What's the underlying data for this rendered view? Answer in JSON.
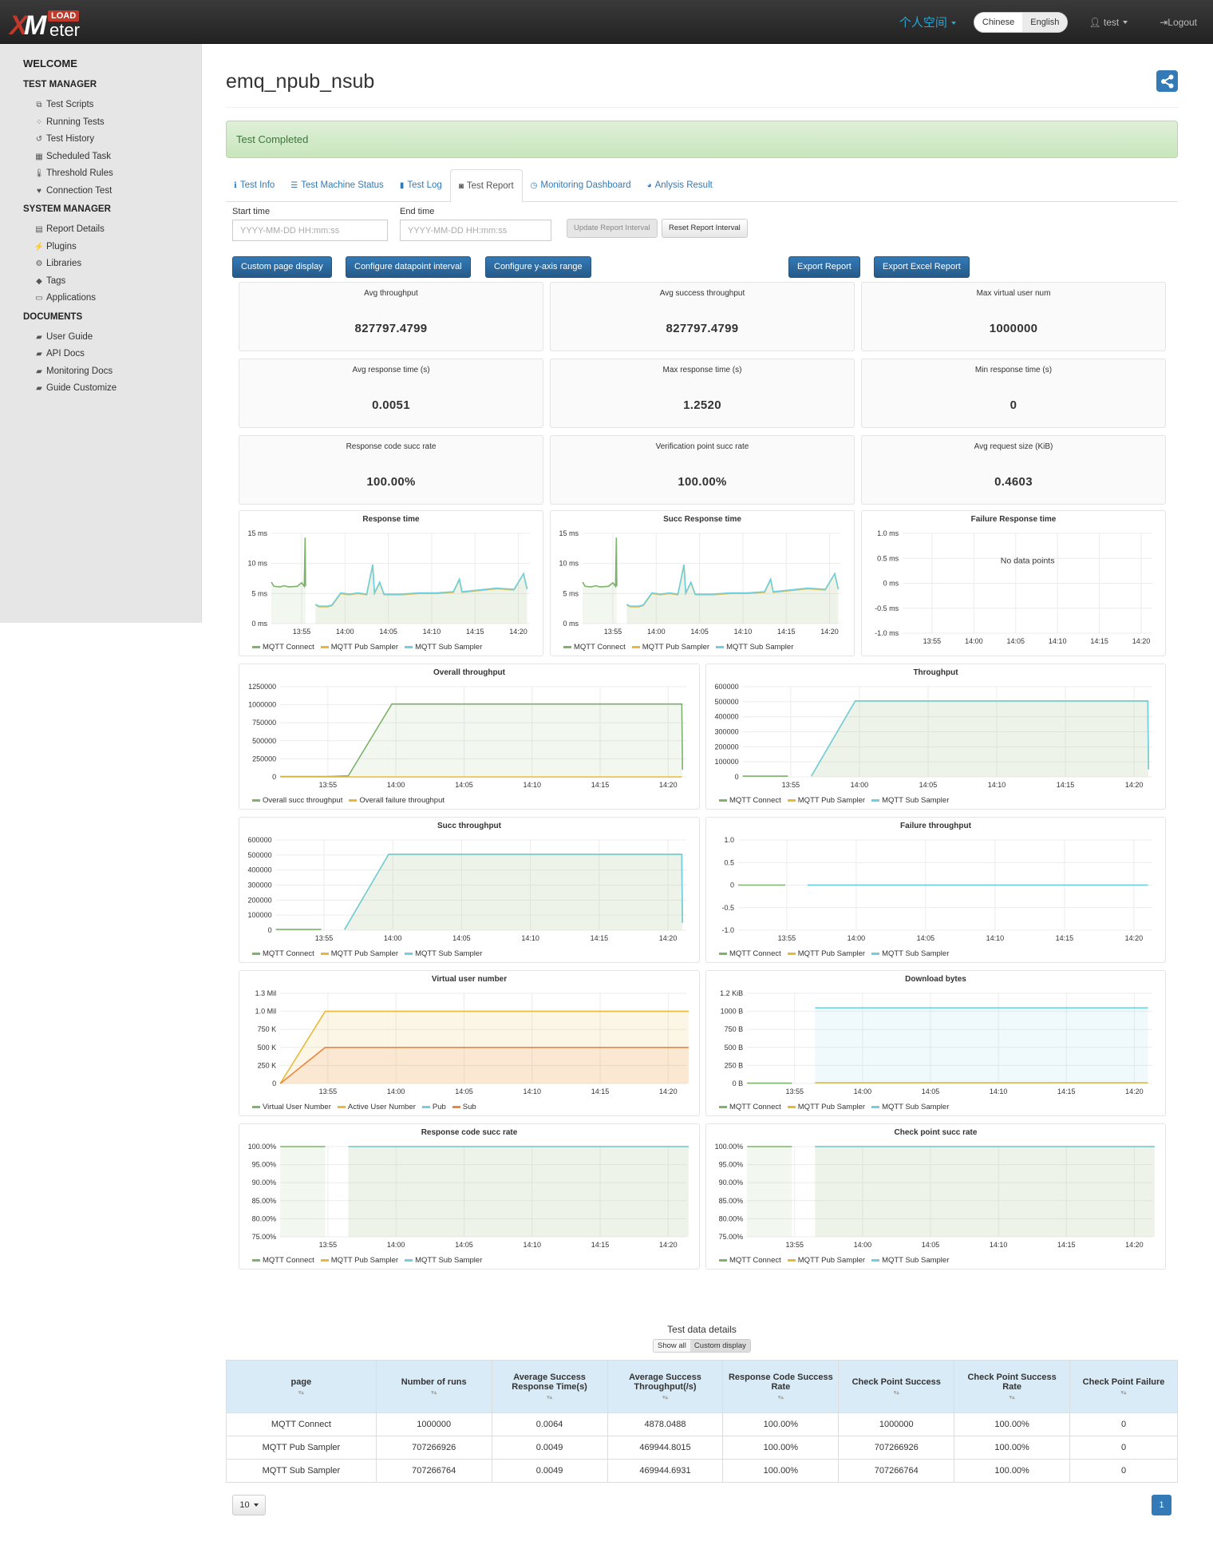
{
  "header": {
    "logo_top": "LOAD",
    "logo_x": "X",
    "logo_m": "M",
    "logo_bottom": "eter",
    "space_label": "个人空间",
    "languages": [
      "Chinese",
      "English"
    ],
    "active_language": "English",
    "user_label": "test",
    "logout_label": "Logout"
  },
  "sidebar": {
    "welcome": "WELCOME",
    "sections": [
      {
        "title": "TEST MANAGER",
        "items": [
          {
            "label": "Test Scripts",
            "icon": "scripts-icon",
            "glyph": "⧉"
          },
          {
            "label": "Running Tests",
            "icon": "spinner-icon",
            "glyph": "⁘"
          },
          {
            "label": "Test History",
            "icon": "history-icon",
            "glyph": "↺"
          },
          {
            "label": "Scheduled Task",
            "icon": "calendar-icon",
            "glyph": "▦"
          },
          {
            "label": "Threshold Rules",
            "icon": "thermometer-icon",
            "glyph": "🌡"
          },
          {
            "label": "Connection Test",
            "icon": "heartbeat-icon",
            "glyph": "♥"
          }
        ]
      },
      {
        "title": "SYSTEM MANAGER",
        "items": [
          {
            "label": "Report Details",
            "icon": "report-icon",
            "glyph": "▤"
          },
          {
            "label": "Plugins",
            "icon": "plug-icon",
            "glyph": "⚡"
          },
          {
            "label": "Libraries",
            "icon": "cogs-icon",
            "glyph": "⚙"
          },
          {
            "label": "Tags",
            "icon": "tags-icon",
            "glyph": "◆"
          },
          {
            "label": "Applications",
            "icon": "laptop-icon",
            "glyph": "▭"
          }
        ]
      },
      {
        "title": "DOCUMENTS",
        "items": [
          {
            "label": "User Guide",
            "icon": "book-icon",
            "glyph": "▰"
          },
          {
            "label": "API Docs",
            "icon": "book-icon",
            "glyph": "▰"
          },
          {
            "label": "Monitoring Docs",
            "icon": "book-icon",
            "glyph": "▰"
          },
          {
            "label": "Guide Customize",
            "icon": "book-icon",
            "glyph": "▰"
          }
        ]
      }
    ]
  },
  "page": {
    "title": "emq_npub_nsub",
    "status": "Test Completed",
    "tabs": [
      {
        "label": "Test Info",
        "icon": "info-icon",
        "glyph": "ℹ"
      },
      {
        "label": "Test Machine Status",
        "icon": "list-icon",
        "glyph": "☰"
      },
      {
        "label": "Test Log",
        "icon": "file-icon",
        "glyph": "▮"
      },
      {
        "label": "Test Report",
        "icon": "report-icon",
        "glyph": "◙"
      },
      {
        "label": "Monitoring Dashboard",
        "icon": "dashboard-icon",
        "glyph": "◷"
      },
      {
        "label": "Anlysis Result",
        "icon": "pie-chart-icon",
        "glyph": "◕"
      }
    ],
    "active_tab": "Test Report",
    "start_time_label": "Start time",
    "end_time_label": "End time",
    "start_time_placeholder": "YYYY-MM-DD HH:mm:ss",
    "end_time_placeholder": "YYYY-MM-DD HH:mm:ss",
    "start_time_value": "",
    "end_time_value": "",
    "update_interval_label": "Update Report Interval",
    "reset_interval_label": "Reset Report Interval",
    "buttons": {
      "custom_page": "Custom page display",
      "datapoint_interval": "Configure datapoint interval",
      "y_axis_range": "Configure y-axis range",
      "export_report": "Export Report",
      "export_excel": "Export Excel Report"
    }
  },
  "stats": [
    {
      "label": "Avg throughput",
      "value": "827797.4799"
    },
    {
      "label": "Avg success throughput",
      "value": "827797.4799"
    },
    {
      "label": "Max virtual user num",
      "value": "1000000"
    },
    {
      "label": "Avg response time (s)",
      "value": "0.0051"
    },
    {
      "label": "Max response time (s)",
      "value": "1.2520"
    },
    {
      "label": "Min response time (s)",
      "value": "0"
    },
    {
      "label": "Response code succ rate",
      "value": "100.00%"
    },
    {
      "label": "Verification point succ rate",
      "value": "100.00%"
    },
    {
      "label": "Avg request size (KiB)",
      "value": "0.4603"
    }
  ],
  "colors": {
    "green": "#7eb26d",
    "yellow": "#eab839",
    "cyan": "#6ed0e0",
    "orange": "#ef843c",
    "primary": "#337ab7"
  },
  "chart_data": [
    {
      "id": "response-time",
      "type": "line",
      "title": "Response time",
      "x_ticks": [
        "13:55",
        "14:00",
        "14:05",
        "14:10",
        "14:15",
        "14:20"
      ],
      "x_range": [
        "13:51:30",
        "14:21:20"
      ],
      "y_ticks": [
        "0 ms",
        "5 ms",
        "10 ms",
        "15 ms"
      ],
      "ylim": [
        0,
        15
      ],
      "unit": "ms",
      "series": [
        {
          "name": "MQTT Connect",
          "color": "#7eb26d",
          "points": [
            [
              0,
              6.9
            ],
            [
              0.3,
              6.2
            ],
            [
              1,
              6.1
            ],
            [
              1.5,
              6.3
            ],
            [
              2,
              6.1
            ],
            [
              3,
              6.2
            ],
            [
              3.5,
              6.8
            ],
            [
              3.8,
              6.2
            ],
            [
              3.9,
              14.3
            ],
            [
              3.95,
              6.2
            ]
          ]
        },
        {
          "name": "MQTT Pub Sampler",
          "color": "#eab839",
          "points": [
            [
              5.1,
              3.1
            ],
            [
              5.5,
              2.8
            ],
            [
              6.5,
              2.8
            ],
            [
              7,
              3
            ],
            [
              7.5,
              4
            ],
            [
              8,
              5
            ],
            [
              9,
              4.8
            ],
            [
              10,
              5
            ],
            [
              11,
              4.8
            ],
            [
              11.7,
              9.8
            ],
            [
              11.9,
              5
            ],
            [
              12.5,
              6.8
            ],
            [
              13,
              4.8
            ],
            [
              15,
              4.8
            ],
            [
              17,
              5
            ],
            [
              19,
              5
            ],
            [
              21,
              5.2
            ],
            [
              21.7,
              7.3
            ],
            [
              22,
              5.2
            ],
            [
              24,
              5.5
            ],
            [
              26,
              5.8
            ],
            [
              28,
              5.6
            ],
            [
              29.1,
              8.3
            ],
            [
              29.5,
              5.7
            ]
          ]
        },
        {
          "name": "MQTT Sub Sampler",
          "color": "#6ed0e0",
          "points": [
            [
              5.1,
              3.2
            ],
            [
              5.5,
              2.9
            ],
            [
              6.5,
              2.9
            ],
            [
              7,
              3.1
            ],
            [
              7.5,
              4.1
            ],
            [
              8,
              5.1
            ],
            [
              9,
              4.9
            ],
            [
              10,
              5.1
            ],
            [
              11,
              4.9
            ],
            [
              11.7,
              9.8
            ],
            [
              11.9,
              5.1
            ],
            [
              12.5,
              6.9
            ],
            [
              13,
              4.9
            ],
            [
              15,
              4.9
            ],
            [
              17,
              5.1
            ],
            [
              19,
              5.1
            ],
            [
              21,
              5.3
            ],
            [
              21.7,
              7.4
            ],
            [
              22,
              5.3
            ],
            [
              24,
              5.6
            ],
            [
              26,
              5.9
            ],
            [
              28,
              5.7
            ],
            [
              29.1,
              8.3
            ],
            [
              29.5,
              5.8
            ]
          ]
        }
      ]
    },
    {
      "id": "succ-response-time",
      "type": "line",
      "title": "Succ Response time",
      "x_ticks": [
        "13:55",
        "14:00",
        "14:05",
        "14:10",
        "14:15",
        "14:20"
      ],
      "y_ticks": [
        "0 ms",
        "5 ms",
        "10 ms",
        "15 ms"
      ],
      "ylim": [
        0,
        15
      ],
      "unit": "ms",
      "series_ref": "response-time"
    },
    {
      "id": "failure-response-time",
      "type": "line",
      "title": "Failure Response time",
      "x_ticks": [
        "13:55",
        "14:00",
        "14:05",
        "14:10",
        "14:15",
        "14:20"
      ],
      "y_ticks": [
        "-1.0 ms",
        "-0.5 ms",
        "0 ms",
        "0.5 ms",
        "1.0 ms"
      ],
      "ylim": [
        -1,
        1
      ],
      "annotation": "No data points",
      "series": []
    },
    {
      "id": "overall-throughput",
      "type": "area",
      "title": "Overall throughput",
      "x_ticks": [
        "13:55",
        "14:00",
        "14:05",
        "14:10",
        "14:15",
        "14:20"
      ],
      "y_ticks": [
        "0",
        "250000",
        "500000",
        "750000",
        "1000000",
        "1250000"
      ],
      "ylim": [
        0,
        1250000
      ],
      "series": [
        {
          "name": "Overall succ throughput",
          "color": "#7eb26d",
          "points": [
            [
              0,
              5000
            ],
            [
              3.5,
              5000
            ],
            [
              5,
              15000
            ],
            [
              8.2,
              1010000
            ],
            [
              29.5,
              1010000
            ],
            [
              29.55,
              100000
            ]
          ]
        },
        {
          "name": "Overall failure throughput",
          "color": "#eab839",
          "points": [
            [
              0,
              0
            ],
            [
              29.5,
              0
            ]
          ]
        }
      ]
    },
    {
      "id": "throughput",
      "type": "area",
      "title": "Throughput",
      "x_ticks": [
        "13:55",
        "14:00",
        "14:05",
        "14:10",
        "14:15",
        "14:20"
      ],
      "y_ticks": [
        "0",
        "100000",
        "200000",
        "300000",
        "400000",
        "500000",
        "600000"
      ],
      "ylim": [
        0,
        600000
      ],
      "series": [
        {
          "name": "MQTT Connect",
          "color": "#7eb26d",
          "points": [
            [
              0,
              5000
            ],
            [
              3.3,
              5000
            ]
          ]
        },
        {
          "name": "MQTT Pub Sampler",
          "color": "#eab839",
          "points": [
            [
              5,
              5000
            ],
            [
              8.2,
              505000
            ],
            [
              29.5,
              505000
            ],
            [
              29.55,
              50000
            ]
          ]
        },
        {
          "name": "MQTT Sub Sampler",
          "color": "#6ed0e0",
          "points": [
            [
              5,
              5000
            ],
            [
              8.2,
              505000
            ],
            [
              29.5,
              505000
            ],
            [
              29.55,
              50000
            ]
          ]
        }
      ]
    },
    {
      "id": "succ-throughput",
      "type": "area",
      "title": "Succ throughput",
      "x_ticks": [
        "13:55",
        "14:00",
        "14:05",
        "14:10",
        "14:15",
        "14:20"
      ],
      "y_ticks": [
        "0",
        "100000",
        "200000",
        "300000",
        "400000",
        "500000",
        "600000"
      ],
      "ylim": [
        0,
        600000
      ],
      "series_ref": "throughput"
    },
    {
      "id": "failure-throughput",
      "type": "line",
      "title": "Failure throughput",
      "x_ticks": [
        "13:55",
        "14:00",
        "14:05",
        "14:10",
        "14:15",
        "14:20"
      ],
      "y_ticks": [
        "-1.0",
        "-0.5",
        "0",
        "0.5",
        "1.0"
      ],
      "ylim": [
        -1,
        1
      ],
      "series": [
        {
          "name": "MQTT Connect",
          "color": "#7eb26d",
          "points": [
            [
              0,
              0
            ],
            [
              3.4,
              0
            ]
          ]
        },
        {
          "name": "MQTT Pub Sampler",
          "color": "#eab839",
          "points": [
            [
              5,
              0
            ],
            [
              29.5,
              0
            ]
          ]
        },
        {
          "name": "MQTT Sub Sampler",
          "color": "#6ed0e0",
          "points": [
            [
              5,
              0
            ],
            [
              29.5,
              0
            ]
          ]
        }
      ]
    },
    {
      "id": "virtual-user-number",
      "type": "area",
      "title": "Virtual user number",
      "x_ticks": [
        "13:55",
        "14:00",
        "14:05",
        "14:10",
        "14:15",
        "14:20"
      ],
      "y_ticks": [
        "0",
        "250 K",
        "500 K",
        "750 K",
        "1.0 Mil",
        "1.3 Mil"
      ],
      "ylim": [
        0,
        1250000
      ],
      "series": [
        {
          "name": "Virtual User Number",
          "color": "#7eb26d",
          "points": []
        },
        {
          "name": "Active User Number",
          "color": "#eab839",
          "points": [
            [
              0,
              0
            ],
            [
              3.3,
              1000000
            ],
            [
              30,
              1000000
            ]
          ]
        },
        {
          "name": "Pub",
          "color": "#6ed0e0",
          "points": []
        },
        {
          "name": "Sub",
          "color": "#ef843c",
          "points": [
            [
              0,
              0
            ],
            [
              3.3,
              500000
            ],
            [
              30,
              500000
            ]
          ]
        }
      ]
    },
    {
      "id": "download-bytes",
      "type": "area",
      "title": "Download bytes",
      "x_ticks": [
        "13:55",
        "14:00",
        "14:05",
        "14:10",
        "14:15",
        "14:20"
      ],
      "y_ticks": [
        "0 B",
        "250 B",
        "500 B",
        "750 B",
        "1000 B",
        "1.2 KiB"
      ],
      "ylim": [
        0,
        1228.8
      ],
      "series": [
        {
          "name": "MQTT Connect",
          "color": "#7eb26d",
          "points": [
            [
              0,
              5
            ],
            [
              3.3,
              5
            ]
          ]
        },
        {
          "name": "MQTT Pub Sampler",
          "color": "#eab839",
          "points": [
            [
              5,
              10
            ],
            [
              29.5,
              10
            ]
          ]
        },
        {
          "name": "MQTT Sub Sampler",
          "color": "#6ed0e0",
          "points": [
            [
              5,
              1030
            ],
            [
              29.5,
              1030
            ]
          ]
        }
      ]
    },
    {
      "id": "response-code-succ-rate",
      "type": "area",
      "title": "Response code succ rate",
      "x_ticks": [
        "13:55",
        "14:00",
        "14:05",
        "14:10",
        "14:15",
        "14:20"
      ],
      "y_ticks": [
        "75.00%",
        "80.00%",
        "85.00%",
        "90.00%",
        "95.00%",
        "100.00%"
      ],
      "ylim": [
        75,
        100
      ],
      "series": [
        {
          "name": "MQTT Connect",
          "color": "#7eb26d",
          "points": [
            [
              0,
              100
            ],
            [
              3.3,
              100
            ]
          ]
        },
        {
          "name": "MQTT Pub Sampler",
          "color": "#eab839",
          "points": [
            [
              5,
              100
            ],
            [
              30,
              100
            ]
          ]
        },
        {
          "name": "MQTT Sub Sampler",
          "color": "#6ed0e0",
          "points": [
            [
              5,
              100
            ],
            [
              30,
              100
            ]
          ]
        }
      ]
    },
    {
      "id": "check-point-succ-rate",
      "type": "area",
      "title": "Check point succ rate",
      "x_ticks": [
        "13:55",
        "14:00",
        "14:05",
        "14:10",
        "14:15",
        "14:20"
      ],
      "y_ticks": [
        "75.00%",
        "80.00%",
        "85.00%",
        "90.00%",
        "95.00%",
        "100.00%"
      ],
      "ylim": [
        75,
        100
      ],
      "series_ref": "response-code-succ-rate"
    }
  ],
  "details": {
    "title": "Test data details",
    "show_all": "Show all",
    "custom_display": "Custom display",
    "columns": [
      "page",
      "Number of runs",
      "Average Success Response Time(s)",
      "Average Success Throughput(/s)",
      "Response Code Success Rate",
      "Check Point Success",
      "Check Point Success Rate",
      "Check Point Failure"
    ],
    "rows": [
      [
        "MQTT Connect",
        "1000000",
        "0.0064",
        "4878.0488",
        "100.00%",
        "1000000",
        "100.00%",
        "0"
      ],
      [
        "MQTT Pub Sampler",
        "707266926",
        "0.0049",
        "469944.8015",
        "100.00%",
        "707266926",
        "100.00%",
        "0"
      ],
      [
        "MQTT Sub Sampler",
        "707266764",
        "0.0049",
        "469944.6931",
        "100.00%",
        "707266764",
        "100.00%",
        "0"
      ]
    ],
    "page_size": "10",
    "current_page": "1"
  }
}
